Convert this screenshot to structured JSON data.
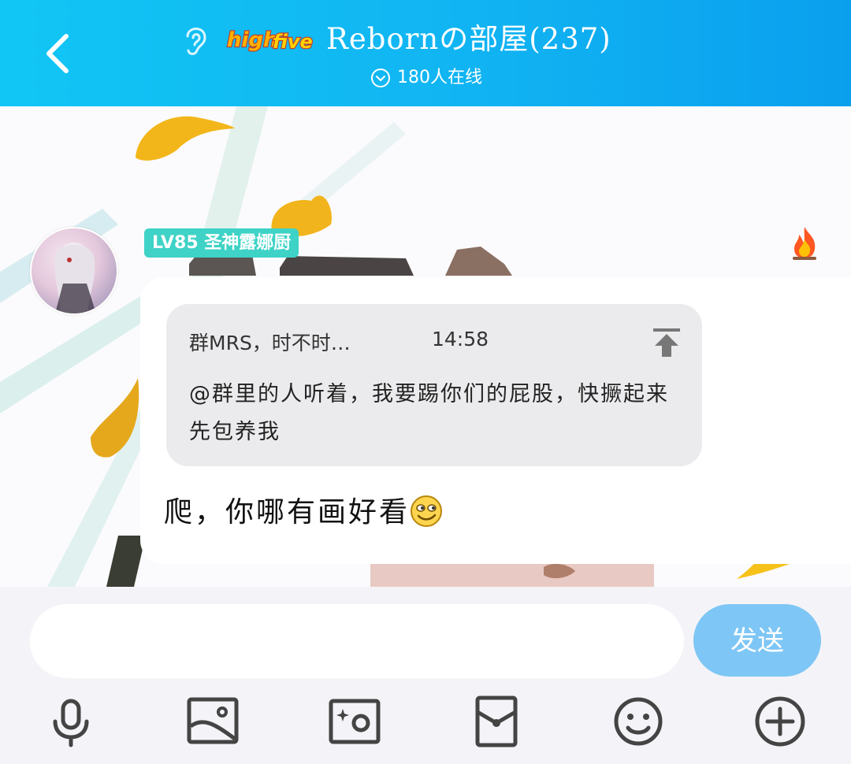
{
  "header": {
    "logo_text": "highfive",
    "room_title": "Rebornの部屋(237)",
    "online_count": "180人在线"
  },
  "message": {
    "level_badge": "LV85 圣神露娜厨",
    "quote_author": "群MRS，时不时…",
    "quote_time": "14:58",
    "quote_text": "@群里的人听着，我要踢你们的屁股，快撅起来 先包养我",
    "text": "爬，你哪有画好看"
  },
  "input": {
    "placeholder": "",
    "send_label": "发送"
  },
  "toolbar": {
    "items": [
      "microphone-icon",
      "image-icon",
      "camera-icon",
      "red-packet-icon",
      "emoji-icon",
      "plus-icon"
    ]
  },
  "colors": {
    "header": "#11b4f2",
    "send_button": "#7ec6f5",
    "level_badge": "#3ed3c6",
    "quote_bg": "#ebebed"
  }
}
